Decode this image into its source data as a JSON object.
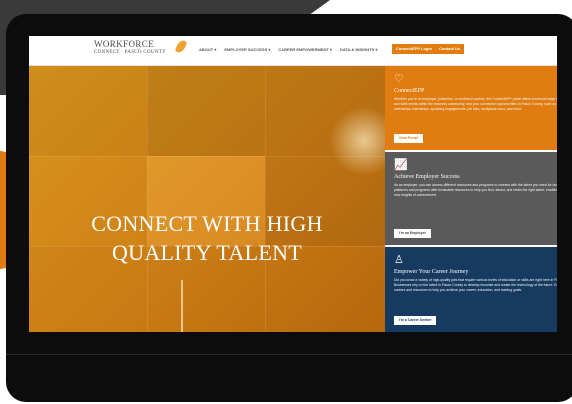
{
  "site": {
    "logo": {
      "main": "WORKFORCE",
      "sub": "CONNECT · PASCO COUNTY"
    },
    "nav": {
      "items": [
        {
          "label": "ABOUT ▾"
        },
        {
          "label": "EMPLOYER SUCCESS ▾"
        },
        {
          "label": "CAREER EMPOWERMENT ▾"
        },
        {
          "label": "DATA & INSIGHTS ▾"
        }
      ],
      "login_label": "ConnectEPP Login",
      "contact_label": "Contact Us"
    },
    "hero": {
      "title_line1": "CONNECT WITH HIGH",
      "title_line2": "QUALITY TALENT"
    },
    "cards": [
      {
        "title": "ConnectEPP",
        "text": "Whether you're an employer, jobseeker, or workforce partner, the ConnectEPP portal offers numerous ways to increase involvement and fulfill needs within the business community, and your connection opportunities in Pasco County, such as opportunities in internships, internships, speaking engagements, job fairs, workplace tours, and more.",
        "button": "View Portal",
        "icon": "heart-icon",
        "color": "#e07c10"
      },
      {
        "title": "Achieve Employer Success",
        "text": "As an employer, you can access different resources and programs to connect with the talent you need for business success. These platforms and programs offer invaluable resources to help you find, attract, and retain the right talent, enabling your business to reach new heights of achievement.",
        "button": "I'm an Employer",
        "icon": "chart-icon",
        "color": "#5a5a5a"
      },
      {
        "title": "Empower Your Career Journey",
        "text": "Did you know a variety of high-quality jobs that require various levels of education or skills are right here in Pasco County? Businesses rely on the talent in Pasco County to develop innovate and create the technology of the future. Explore in-demand careers and resources to help you achieve your career, education, and training goals.",
        "button": "I'm a Career Seeker",
        "icon": "person-icon",
        "color": "#163a60"
      }
    ]
  },
  "colors": {
    "brand_orange": "#e07c10",
    "gray": "#5a5a5a",
    "navy": "#163a60"
  }
}
